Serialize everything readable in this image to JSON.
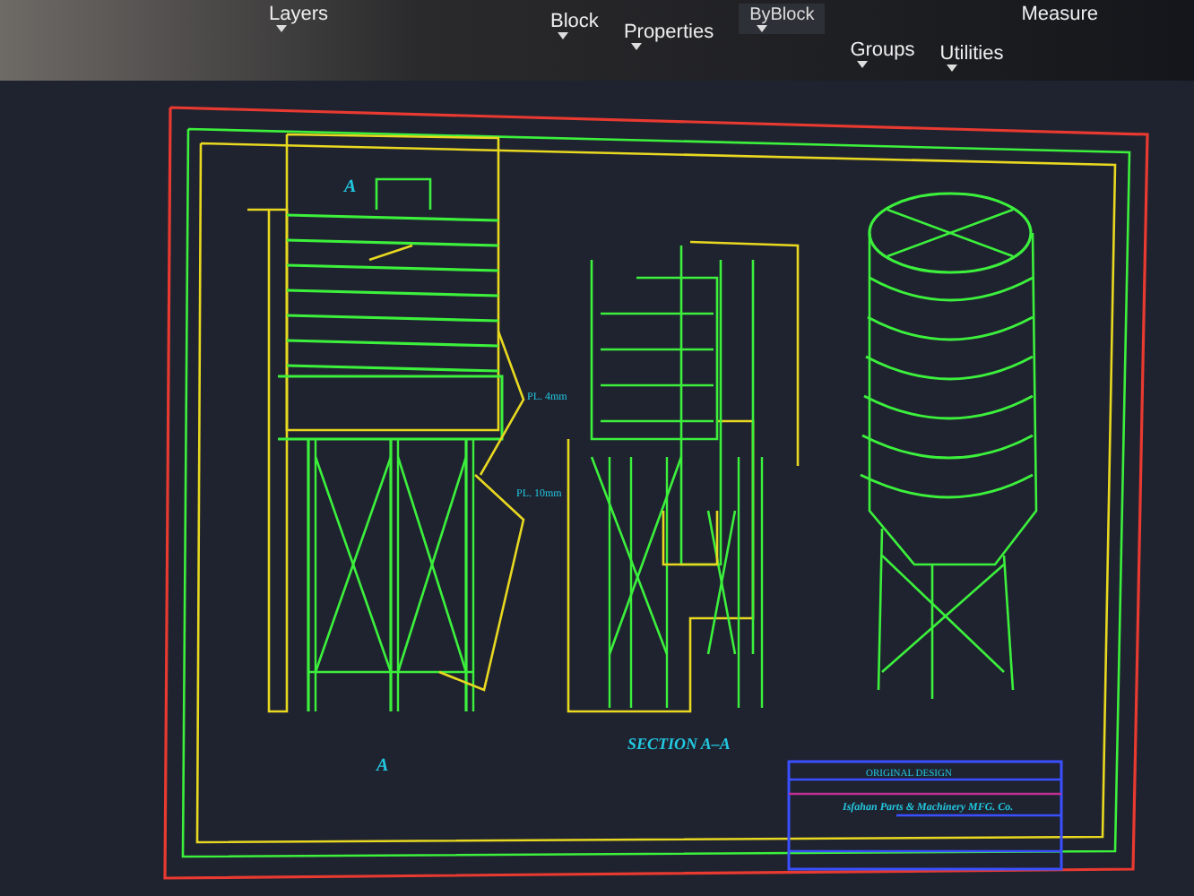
{
  "ribbon": {
    "panels": [
      {
        "label": "Layers"
      },
      {
        "label": "Block"
      },
      {
        "label": "Properties"
      },
      {
        "label": "Groups"
      },
      {
        "label": "Utilities"
      }
    ],
    "linetype_field": {
      "value": "ByBlock"
    },
    "measure_tool": {
      "label": "Measure"
    }
  },
  "drawing": {
    "view_labels": [
      "A",
      "A"
    ],
    "section_title": "SECTION A–A",
    "callouts": [
      "PL. 4mm",
      "PL. 10mm"
    ],
    "title_block": {
      "header": "ORIGINAL DESIGN",
      "company": "Isfahan Parts & Machinery MFG. Co."
    }
  }
}
